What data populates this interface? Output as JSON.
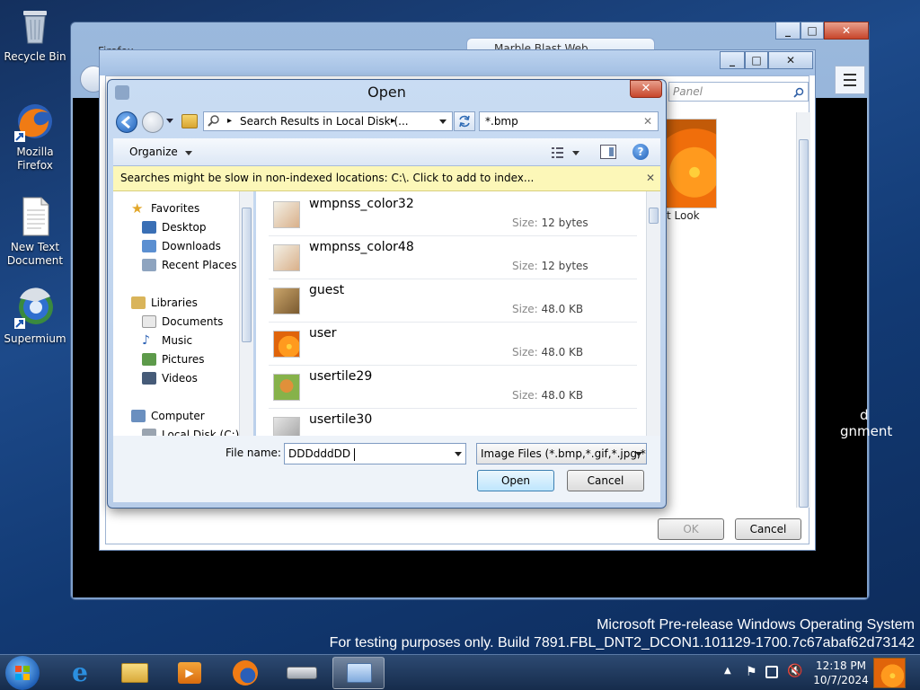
{
  "desktop": {
    "icons": [
      {
        "label": "Recycle Bin"
      },
      {
        "label": "Mozilla Firefox"
      },
      {
        "label": "New Text Document"
      },
      {
        "label": "Supermium"
      }
    ]
  },
  "browser": {
    "tab_title": "Firefox ",
    "tab2_title": "Marble Blast Web",
    "right_partial": [
      "d",
      "gnment"
    ],
    "preview_caption": "t Look"
  },
  "settings_window": {
    "search_placeholder": "Panel",
    "ok_label": "OK",
    "cancel_label": "Cancel"
  },
  "dialog": {
    "title": "Open",
    "address": "Search Results in Local Disk (...",
    "search_value": "*.bmp",
    "organize_label": "Organize",
    "info_bar": "Searches might be slow in non-indexed locations: C:\\. Click to add to index...",
    "nav": {
      "favorites": "Favorites",
      "desktop": "Desktop",
      "downloads": "Downloads",
      "recent_places": "Recent Places",
      "libraries": "Libraries",
      "documents": "Documents",
      "music": "Music",
      "pictures": "Pictures",
      "videos": "Videos",
      "computer": "Computer",
      "local_disk": "Local Disk (C:)"
    },
    "files": [
      {
        "name": "wmpnss_color32",
        "size_label": "Size:",
        "size": "12 bytes"
      },
      {
        "name": "wmpnss_color48",
        "size_label": "Size:",
        "size": "12 bytes"
      },
      {
        "name": "guest",
        "size_label": "Size:",
        "size": "48.0 KB"
      },
      {
        "name": "user",
        "size_label": "Size:",
        "size": "48.0 KB"
      },
      {
        "name": "usertile29",
        "size_label": "Size:",
        "size": "48.0 KB"
      },
      {
        "name": "usertile30",
        "size_label": "",
        "size": ""
      }
    ],
    "file_name_label": "File name:",
    "file_name_value": "DDDdddDD",
    "file_type": "Image Files (*.bmp,*.gif,*.jpg,*.j",
    "open_label": "Open",
    "cancel_label": "Cancel"
  },
  "watermark": {
    "line1": "Microsoft Pre-release Windows Operating System",
    "line2": "For testing purposes only. Build 7891.FBL_DNT2_DCON1.101129-1700.7c67abaf62d73142"
  },
  "taskbar": {
    "time": "12:18 PM",
    "date": "10/7/2024"
  },
  "colors": {
    "accent": "#1d4a8a",
    "info_bar": "#fcf7b8",
    "close_red": "#c7462b"
  }
}
